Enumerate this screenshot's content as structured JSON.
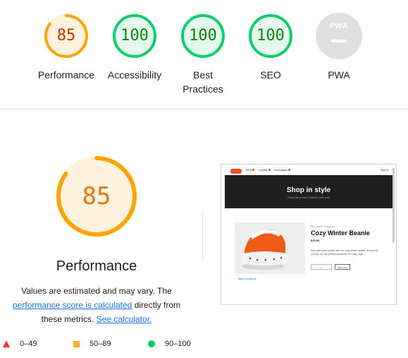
{
  "colors": {
    "average": "#ffa400",
    "average_text": "#c33300",
    "pass": "#0cce6b",
    "pass_text": "#008800",
    "fail": "#ff3333",
    "pwa_grey": "#e0e0e0",
    "link": "#1a73e8"
  },
  "gauges": [
    {
      "score": 85,
      "label": "Performance",
      "rating": "average"
    },
    {
      "score": 100,
      "label": "Accessibility",
      "rating": "pass"
    },
    {
      "score": 100,
      "label": "Best Practices",
      "rating": "pass"
    },
    {
      "score": 100,
      "label": "SEO",
      "rating": "pass"
    },
    {
      "badge": "PWA",
      "label": "PWA",
      "rating": "na"
    }
  ],
  "performance": {
    "score": 85,
    "title": "Performance",
    "desc_prefix": "Values are estimated and may vary. The",
    "score_link": "performance score is calculated",
    "desc_middle": "directly from these metrics.",
    "calculator_link": "See calculator."
  },
  "legend": [
    {
      "icon": "triangle-fail-icon",
      "range": "0–49"
    },
    {
      "icon": "square-average-icon",
      "range": "50–89"
    },
    {
      "icon": "circle-pass-icon",
      "range": "90–100"
    }
  ],
  "screenshot": {
    "nav_items": [
      "Shop",
      "Courses",
      "Subscription"
    ],
    "cart": "Sign In",
    "hero_title": "Shop in style",
    "hero_sub": "Fancy this product? Add it to your cart!",
    "breadcrumb": "Sun | prod. & supplies",
    "product_title": "Cozy Winter Beanie",
    "price": "$19.99",
    "description": "Stay warm and stylish with our cozy winter beanie. A blend for comfort, it's the perfect accessory for chilly days.",
    "qty": "1",
    "add_button": "Add to cart",
    "back_link": "← Back to products"
  }
}
